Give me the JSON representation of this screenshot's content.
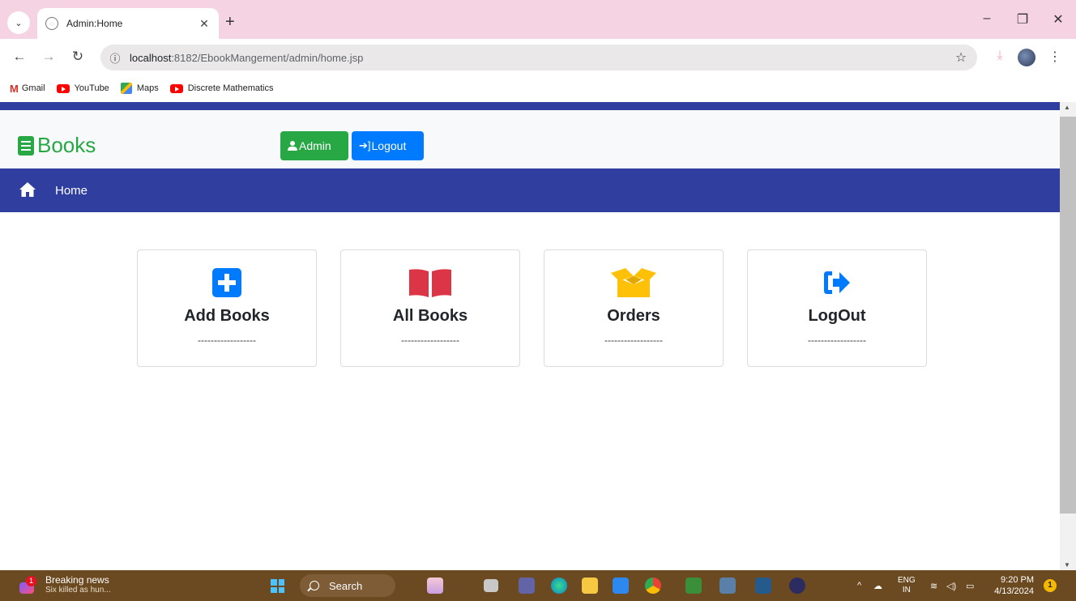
{
  "browser": {
    "tab_title": "Admin:Home",
    "url_host": "localhost",
    "url_path": ":8182/EbookMangement/admin/home.jsp",
    "bookmarks": [
      "Gmail",
      "YouTube",
      "Maps",
      "Discrete Mathematics"
    ]
  },
  "header": {
    "brand": "Books",
    "admin_button": "Admin",
    "logout_button": "Logout"
  },
  "nav": {
    "home": "Home"
  },
  "cards": [
    {
      "title": "Add Books",
      "divider": "------------------",
      "icon": "plus-square-icon",
      "color": "#007bff"
    },
    {
      "title": "All Books",
      "divider": "------------------",
      "icon": "book-open-icon",
      "color": "#dc3545"
    },
    {
      "title": "Orders",
      "divider": "------------------",
      "icon": "box-open-icon",
      "color": "#ffc107"
    },
    {
      "title": "LogOut",
      "divider": "------------------",
      "icon": "sign-out-icon",
      "color": "#007bff"
    }
  ],
  "colors": {
    "primary_nav": "#303f9f",
    "brand_green": "#28a745",
    "button_blue": "#007bff"
  },
  "taskbar": {
    "news_title": "Breaking news",
    "news_subtitle": "Six killed as hun...",
    "news_badge": "1",
    "search_label": "Search",
    "language_top": "ENG",
    "language_bottom": "IN",
    "time": "9:20 PM",
    "date": "4/13/2024",
    "notifications": "1"
  }
}
